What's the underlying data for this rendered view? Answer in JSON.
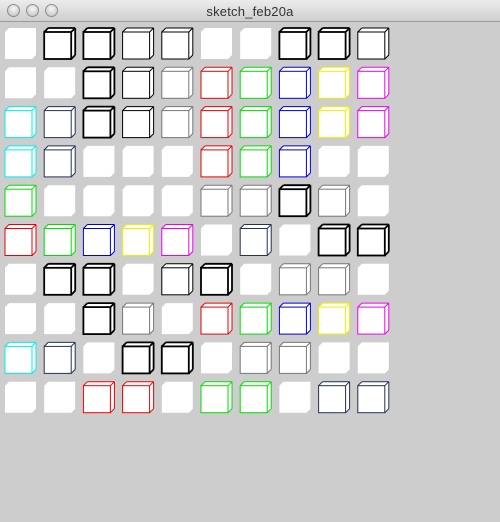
{
  "window": {
    "title": "sketch_feb20a",
    "controls": [
      {
        "name": "close",
        "icon": "close-icon"
      },
      {
        "name": "minimize",
        "icon": "minimize-icon"
      },
      {
        "name": "zoom",
        "icon": "zoom-icon"
      }
    ]
  },
  "palette": {
    "k": "#000000",
    "g": "#777777",
    "r": "#ee0000",
    "G": "#00dd00",
    "b": "#0000dd",
    "y": "#eeee00",
    "m": "#ee00ee",
    "c": "#00eeee",
    "n": "#223355"
  },
  "sketch": {
    "rows": [
      [
        "w",
        "kb",
        "kb",
        "k",
        "k",
        "w",
        "w",
        "kb",
        "kb",
        "k"
      ],
      [
        "w",
        "w",
        "kb",
        "k",
        "g",
        "r",
        "G",
        "b",
        "y",
        "m"
      ],
      [
        "c",
        "n",
        "kb",
        "k",
        "g",
        "r",
        "G",
        "b",
        "y",
        "m"
      ],
      [
        "c",
        "n",
        "w",
        "w",
        "w",
        "r",
        "G",
        "b",
        "w",
        "w"
      ],
      [
        "G",
        "w",
        "w",
        "w",
        "w",
        "g",
        "g",
        "kb",
        "g",
        "w"
      ],
      [
        "r",
        "G",
        "b",
        "y",
        "m",
        "w",
        "n",
        "w",
        "kb",
        "kb"
      ],
      [
        "w",
        "kb",
        "kb",
        "w",
        "k",
        "kb",
        "w",
        "g",
        "g",
        "w"
      ],
      [
        "w",
        "w",
        "kb",
        "g",
        "w",
        "r",
        "G",
        "b",
        "y",
        "m"
      ],
      [
        "c",
        "n",
        "w",
        "kb",
        "kb",
        "w",
        "g",
        "g",
        "w",
        "w"
      ],
      [
        "w",
        "w",
        "r",
        "r",
        "w",
        "G",
        "G",
        "w",
        "n",
        "n"
      ]
    ]
  }
}
